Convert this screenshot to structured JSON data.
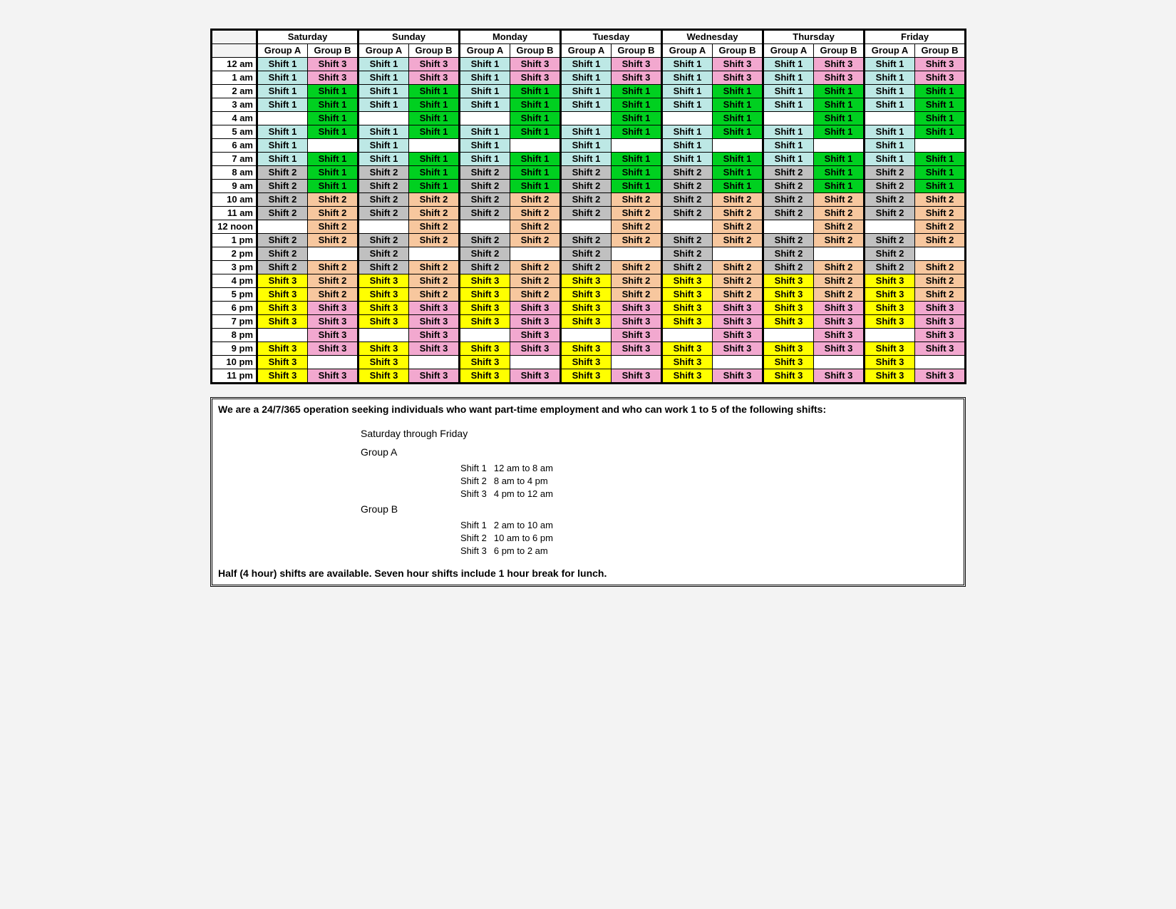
{
  "days": [
    "Saturday",
    "Sunday",
    "Monday",
    "Tuesday",
    "Wednesday",
    "Thursday",
    "Friday"
  ],
  "groups": [
    "Group A",
    "Group B"
  ],
  "timeLabels": [
    "12 am",
    "1 am",
    "2 am",
    "3 am",
    "4 am",
    "5 am",
    "6 am",
    "7 am",
    "8 am",
    "9 am",
    "10 am",
    "11 am",
    "12 noon",
    "1 pm",
    "2 pm",
    "3 pm",
    "4 pm",
    "5 pm",
    "6 pm",
    "7 pm",
    "8 pm",
    "9 pm",
    "10 pm",
    "11 pm"
  ],
  "shiftLabels": {
    "1": "Shift 1",
    "2": "Shift 2",
    "3": "Shift 3"
  },
  "colorMap": {
    "A-1": "c-s1a",
    "A-2": "c-s2g",
    "A-3": "c-s3y",
    "B-1": "c-s1g",
    "B-2": "c-s2p",
    "B-3": "c-s3p"
  },
  "groupA_schedule": [
    1,
    1,
    1,
    1,
    null,
    1,
    1,
    1,
    2,
    2,
    2,
    2,
    null,
    2,
    2,
    2,
    3,
    3,
    3,
    3,
    null,
    3,
    3,
    3
  ],
  "groupB_schedule": [
    3,
    3,
    1,
    1,
    1,
    1,
    null,
    1,
    1,
    1,
    2,
    2,
    2,
    2,
    null,
    2,
    2,
    2,
    3,
    3,
    3,
    3,
    null,
    3
  ],
  "info": {
    "headline": "We are a 24/7/365 operation seeking individuals who want part-time employment and who can work 1 to 5 of the following shifts:",
    "dayRange": "Saturday through Friday",
    "groups": [
      {
        "title": "Group A",
        "rows": [
          {
            "name": "Shift 1",
            "time": "12 am to 8 am"
          },
          {
            "name": "Shift 2",
            "time": "8 am to 4 pm"
          },
          {
            "name": "Shift 3",
            "time": "4 pm to 12 am"
          }
        ]
      },
      {
        "title": "Group B",
        "rows": [
          {
            "name": "Shift 1",
            "time": "2 am to 10 am"
          },
          {
            "name": "Shift 2",
            "time": "10 am to 6 pm"
          },
          {
            "name": "Shift 3",
            "time": "6 pm to 2 am"
          }
        ]
      }
    ],
    "footer": "Half (4 hour) shifts are available.  Seven hour shifts include 1 hour break for lunch."
  }
}
